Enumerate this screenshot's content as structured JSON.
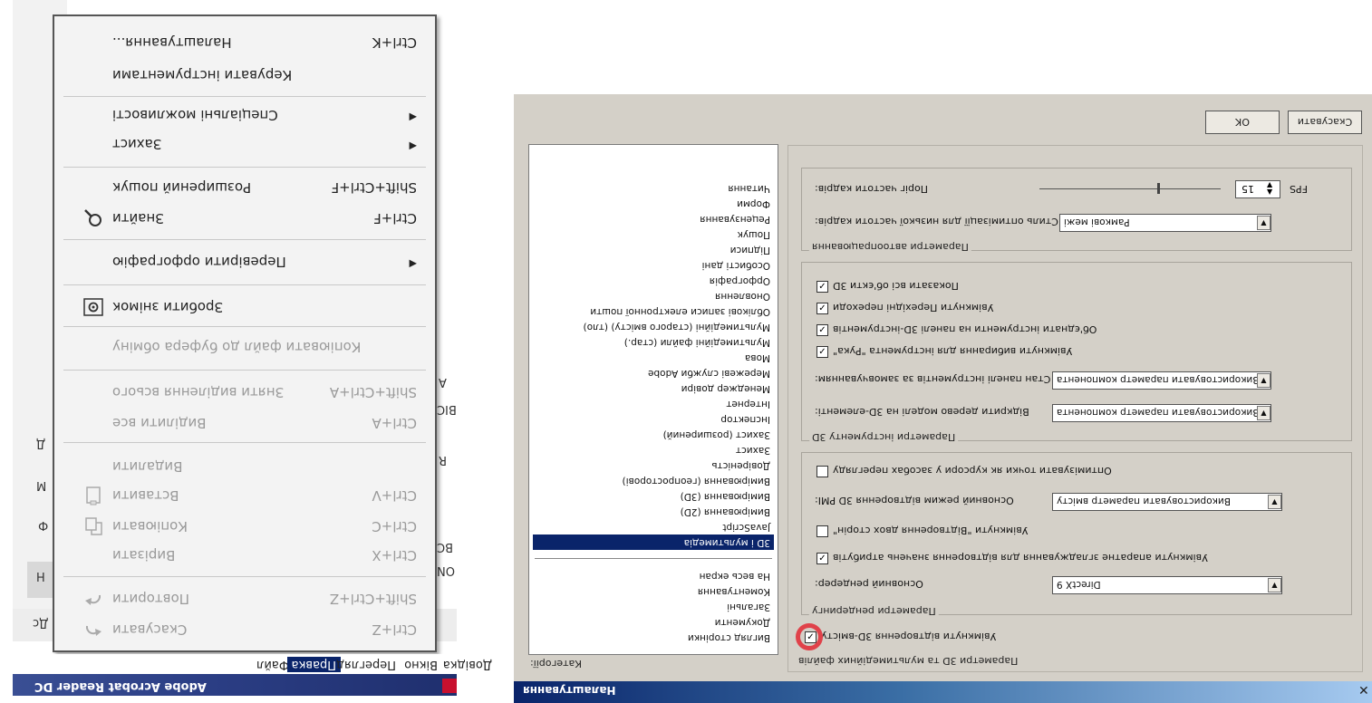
{
  "acrobat": {
    "title": "Adobe Acrobat Reader DC",
    "menubar": [
      {
        "label": "Файл",
        "selected": false
      },
      {
        "label": "Правка",
        "selected": true
      },
      {
        "label": "Перегляд",
        "selected": false
      },
      {
        "label": "Вікно",
        "selected": false
      },
      {
        "label": "Довідка",
        "selected": false
      }
    ],
    "background_stubs": [
      "Дс",
      "Н",
      "Ф",
      "М",
      "Д",
      "R",
      "ВС",
      "ОN",
      "ВІС",
      "А"
    ],
    "edit_menu": [
      {
        "label": "Скасувати",
        "shortcut": "Ctrl+Z",
        "icon": "undo-icon",
        "disabled": true
      },
      {
        "label": "Повторити",
        "shortcut": "Shift+Ctrl+Z",
        "icon": "redo-icon",
        "disabled": true
      },
      {
        "label": "Вирізати",
        "shortcut": "Ctrl+X",
        "icon": "",
        "disabled": true
      },
      {
        "label": "Копіювати",
        "shortcut": "Ctrl+C",
        "icon": "copy-icon",
        "disabled": true
      },
      {
        "label": "Вставити",
        "shortcut": "Ctrl+V",
        "icon": "paste-icon",
        "disabled": true
      },
      {
        "label": "Видалити",
        "shortcut": "",
        "icon": "",
        "disabled": true
      },
      {
        "label": "Виділити все",
        "shortcut": "Ctrl+A",
        "icon": "",
        "disabled": true
      },
      {
        "label": "Зняти виділення всього",
        "shortcut": "Shift+Ctrl+A",
        "icon": "",
        "disabled": true
      },
      {
        "label": "Копіювати файл до буфера обміну",
        "shortcut": "",
        "icon": "",
        "disabled": true
      },
      {
        "label": "Зробити знімок",
        "shortcut": "",
        "icon": "snapshot-icon",
        "disabled": false
      },
      {
        "label": "Перевірити орфографію",
        "shortcut": "",
        "icon": "",
        "disabled": false,
        "submenu": true
      },
      {
        "label": "Знайти",
        "shortcut": "Ctrl+F",
        "icon": "search-icon",
        "disabled": false
      },
      {
        "label": "Розширений пошук",
        "shortcut": "Shift+Ctrl+F",
        "icon": "",
        "disabled": false
      },
      {
        "label": "Захист",
        "shortcut": "",
        "icon": "",
        "disabled": false,
        "submenu": true
      },
      {
        "label": "Спеціальні можливості",
        "shortcut": "",
        "icon": "",
        "disabled": false,
        "submenu": true
      },
      {
        "label": "Керувати інструментами",
        "shortcut": "",
        "icon": "",
        "disabled": false
      },
      {
        "label": "Налаштування...",
        "shortcut": "Ctrl+K",
        "icon": "",
        "disabled": false
      }
    ]
  },
  "preferences": {
    "title": "Налаштування",
    "ok_label": "OK",
    "cancel_label": "Скасувати",
    "categories_label": "Категорії:",
    "categories": [
      {
        "label": "Вигляд сторінки",
        "selected": false
      },
      {
        "label": "Документи",
        "selected": false
      },
      {
        "label": "Загальні",
        "selected": false
      },
      {
        "label": "Коментування",
        "selected": false
      },
      {
        "label": "На весь екран",
        "selected": false
      },
      {
        "label": "3D і мультимедіа",
        "selected": true
      },
      {
        "label": "JavaScript",
        "selected": false
      },
      {
        "label": "Вимірювання (2D)",
        "selected": false
      },
      {
        "label": "Вимірювання (3D)",
        "selected": false
      },
      {
        "label": "Вимірювання (геопросторові)",
        "selected": false
      },
      {
        "label": "Довіреність",
        "selected": false
      },
      {
        "label": "Захист",
        "selected": false
      },
      {
        "label": "Захист (розширений)",
        "selected": false
      },
      {
        "label": "Інспектор",
        "selected": false
      },
      {
        "label": "Інтернет",
        "selected": false
      },
      {
        "label": "Менеджер довіри",
        "selected": false
      },
      {
        "label": "Мережеві служби Adobe",
        "selected": false
      },
      {
        "label": "Мова",
        "selected": false
      },
      {
        "label": "Мультимедійні файли (стар.)",
        "selected": false
      },
      {
        "label": "Мультимедійні (старого вмісту) (тло)",
        "selected": false
      },
      {
        "label": "Облікові записи електронної пошти",
        "selected": false
      },
      {
        "label": "Оновлення",
        "selected": false
      },
      {
        "label": "Орфографія",
        "selected": false
      },
      {
        "label": "Особисті дані",
        "selected": false
      },
      {
        "label": "Підписи",
        "selected": false
      },
      {
        "label": "Пошук",
        "selected": false
      },
      {
        "label": "Рецензування",
        "selected": false
      },
      {
        "label": "Форми",
        "selected": false
      },
      {
        "label": "Читання",
        "selected": false
      }
    ],
    "main_section_caption": "Параметри 3D та мультимедійних файлів",
    "enable_3d_label": "Увімкнути відтворення 3D-вмісту",
    "enable_3d_checked": true,
    "render_group": {
      "caption": "Параметри рендерингу",
      "renderer_label": "Основний рендерер:",
      "renderer_value": "DirectX 9",
      "hw_label": "Увімкнути апаратне згладжування для відтворення значень атрибутів",
      "hw_checked": true,
      "dblside_label": "Увімкнути \"Відтворення двох сторін\"",
      "dblside_checked": false,
      "mode_label": "Основний режим відтворення 3D PMI:",
      "mode_value": "Використовувати параметр вмісту",
      "optimize_label": "Оптимізувати точки як курсори у засобах перегляду",
      "optimize_checked": false
    },
    "tools_group": {
      "caption": "Параметри інструменту 3D",
      "tree_label": "Відкрити дерево моделі на 3D-елементі:",
      "tree_value": "Використовувати параметр компонента",
      "toolbar_label": "Стан панелі інструментів за замовчуванням:",
      "toolbar_value": "Використовувати параметр компонента",
      "hand_label": "Увімкнути вибирання для інструмента \"Рука\"",
      "hand_checked": true,
      "consolidate_label": "Об'єднати інструменти на панелі 3D-інструментів",
      "consolidate_checked": true,
      "views_label": "Увімкнути Перехідні переходи",
      "views_checked": true,
      "showall_label": "Показати всі об'єкти 3D",
      "showall_checked": true
    },
    "auto_group": {
      "caption": "Параметри автоопрацювання",
      "strategy_label": "Стиль оптимізації для низької частоти кадрів:",
      "strategy_value": "Рамкові межі",
      "fps_label": "Поріг частоти кадрів:",
      "fps_value": "15",
      "fps_unit": "FPS",
      "fps_level": 0.35
    }
  }
}
